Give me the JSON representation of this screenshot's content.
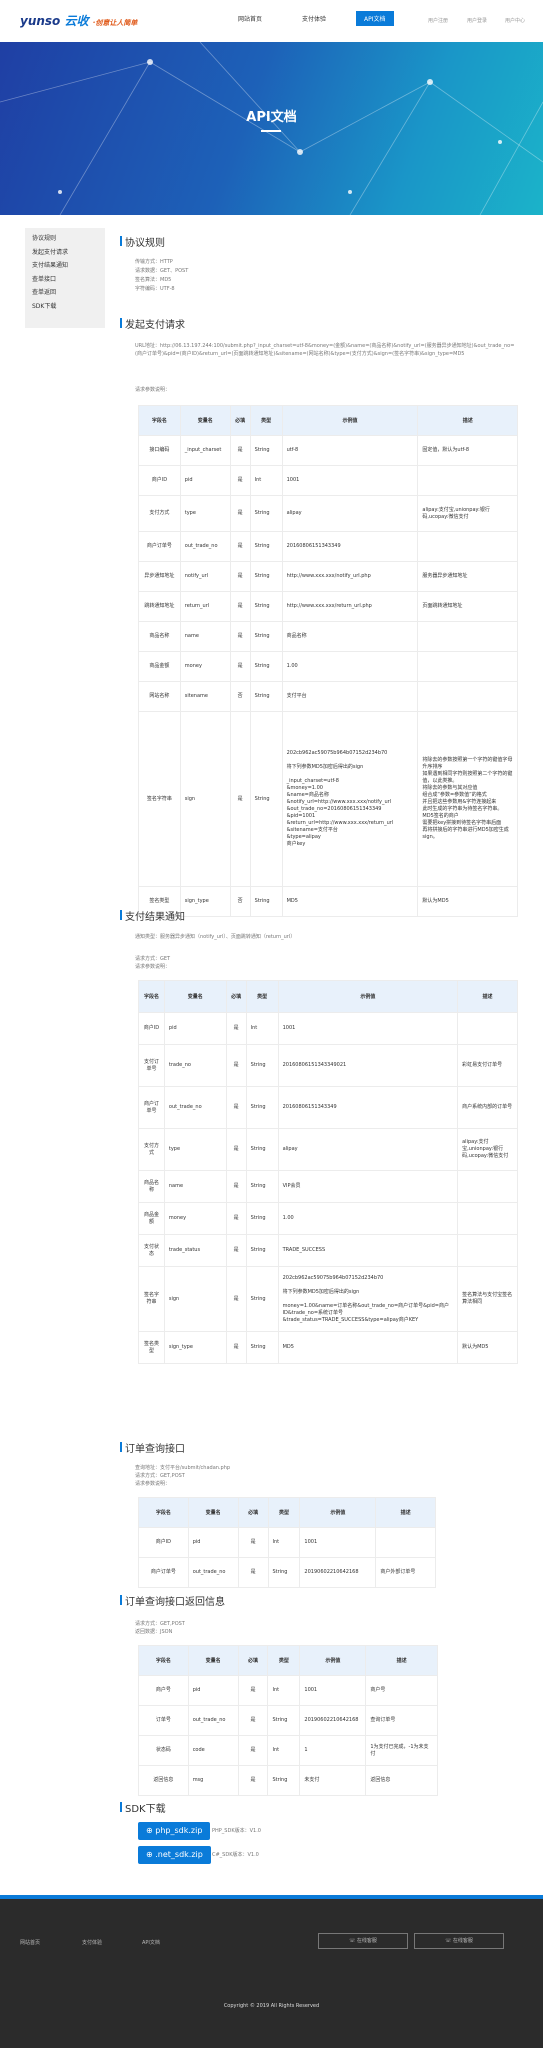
{
  "header": {
    "logo_main": "yunso",
    "logo_cn": "云收",
    "logo_slogan": "·创意让人简单",
    "nav": [
      "网站首页",
      "支付体验",
      "API文档"
    ],
    "links": [
      "用户注册",
      "用户登录",
      "用户中心"
    ]
  },
  "hero": {
    "title": "API文档"
  },
  "sidebar": [
    "协议规则",
    "发起支付请求",
    "支付结果通知",
    "查单接口",
    "查单返回",
    "SDK下载"
  ],
  "s1": {
    "title": "协议规则",
    "lines": [
      "传输方式：HTTP",
      "请求数据：GET、POST",
      "签名算法：MD5",
      "字符编码：UTF-8"
    ]
  },
  "s2": {
    "title": "发起支付请求",
    "url": "URL地址：http://06.13.197.244:100/submit.php?_input_charset=utf-8&money=(金额)&name=(商品名称)&notify_url=(服务器异步通知地址)&out_trade_no=(商户订单号)&pid=(商户ID)&return_url=(页面跳转通知地址)&sitename=(网站名称)&type=(支付方式)&sign=(签名字符串)&sign_type=MD5",
    "param_note": "请求参数说明：",
    "headers": [
      "字段名",
      "变量名",
      "必填",
      "类型",
      "示例值",
      "描述"
    ],
    "rows": [
      [
        "接口编码",
        "_input_charset",
        "是",
        "String",
        "utf-8",
        "固定值，默认为utf-8"
      ],
      [
        "商户ID",
        "pid",
        "是",
        "Int",
        "1001",
        ""
      ],
      [
        "支付方式",
        "type",
        "是",
        "String",
        "alipay",
        "alipay:支付宝,unionpay:银行码,ucopay:微信支付"
      ],
      [
        "商户订单号",
        "out_trade_no",
        "是",
        "String",
        "20160806151343349",
        ""
      ],
      [
        "异步通知地址",
        "notify_url",
        "是",
        "String",
        "http://www.xxx.xxx/notify_url.php",
        "服务器异步通知地址"
      ],
      [
        "跳转通知地址",
        "return_url",
        "是",
        "String",
        "http://www.xxx.xxx/return_url.php",
        "页面跳转通知地址"
      ],
      [
        "商品名称",
        "name",
        "是",
        "String",
        "商品名称",
        ""
      ],
      [
        "商品金额",
        "money",
        "是",
        "String",
        "1.00",
        ""
      ],
      [
        "网站名称",
        "sitename",
        "否",
        "String",
        "支付平台",
        ""
      ],
      [
        "签名字符串",
        "sign",
        "是",
        "String",
        "202cb962ac59075b964b07152d234b70\n\n将下列参数MD5加密后得出的sign\n\n_input_charset=utf-8\n&money=1.00\n&name=商品名称\n&notify_url=http://www.xxx.xxx/notify_url\n&out_trade_no=20160806151343349\n&pid=1001\n&return_url=http://www.xxx.xxx/return_url\n&sitename=支付平台\n&type=alipay\n商户key",
        "将除去的参数按照第一个字符的键值字母升序排序\n如果遇到相同字符则按照第二个字符的键值，以此类推。\n将除去的参数与其对应值\n组合成“参数=参数值”的格式\n并且把这些参数用&字符连接起来\n此时生成的字符串为待签名字符串。\nMD5签名的商户\n需要把key拼接到待签名字符串后面\n再将拼接后的字符串进行MD5加密生成sign。"
      ],
      [
        "签名类型",
        "sign_type",
        "否",
        "String",
        "MD5",
        "默认为MD5"
      ]
    ],
    "sign_link": "支付宝签名算法"
  },
  "s3": {
    "title": "支付结果通知",
    "desc": "通知类型：服务器异步通知（notify_url）、页面跳转通知（return_url）",
    "lines": [
      "请求方式：GET",
      "请求参数说明："
    ],
    "headers": [
      "字段名",
      "变量名",
      "必填",
      "类型",
      "示例值",
      "描述"
    ],
    "rows": [
      [
        "商户ID",
        "pid",
        "是",
        "Int",
        "1001",
        ""
      ],
      [
        "支付订单号",
        "trade_no",
        "是",
        "String",
        "20160806151343349021",
        "彩虹易支付订单号"
      ],
      [
        "商户订单号",
        "out_trade_no",
        "是",
        "String",
        "20160806151343349",
        "商户系统内部的订单号"
      ],
      [
        "支付方式",
        "type",
        "是",
        "String",
        "alipay",
        "alipay:支付宝,unionpay:银行码,ucopay:微信支付"
      ],
      [
        "商品名称",
        "name",
        "是",
        "String",
        "VIP会员",
        ""
      ],
      [
        "商品金额",
        "money",
        "是",
        "String",
        "1.00",
        ""
      ],
      [
        "支付状态",
        "trade_status",
        "是",
        "String",
        "TRADE_SUCCESS",
        ""
      ],
      [
        "签名字符串",
        "sign",
        "是",
        "String",
        "202cb962ac59075b964b07152d234b70\n\n将下列参数MD5加密后得出的sign\n\nmoney=1.00&name=订单名称&out_trade_no=商户订单号&pid=商户ID&trade_no=系统订单号&trade_status=TRADE_SUCCESS&type=alipay商户KEY",
        "签名算法与支付宝签名算法相同"
      ],
      [
        "签名类型",
        "sign_type",
        "是",
        "String",
        "MD5",
        "默认为MD5"
      ]
    ]
  },
  "s4": {
    "title": "订单查询接口",
    "lines": [
      "查询地址：支付平台/submit/chadan.php",
      "请求方式：GET,POST",
      "请求参数说明："
    ],
    "headers": [
      "字段名",
      "变量名",
      "必填",
      "类型",
      "示例值",
      "描述"
    ],
    "rows": [
      [
        "商户ID",
        "pid",
        "是",
        "Int",
        "1001",
        ""
      ],
      [
        "商户订单号",
        "out_trade_no",
        "是",
        "String",
        "20190602210642168",
        "商户外部订单号"
      ]
    ]
  },
  "s5": {
    "title": "订单查询接口返回信息",
    "lines": [
      "请求方式：GET,POST",
      "返回数据：JSON"
    ],
    "headers": [
      "字段名",
      "变量名",
      "必填",
      "类型",
      "示例值",
      "描述"
    ],
    "rows": [
      [
        "商户号",
        "pid",
        "是",
        "Int",
        "1001",
        "商户号"
      ],
      [
        "订单号",
        "out_trade_no",
        "是",
        "String",
        "20190602210642168",
        "查询订单号"
      ],
      [
        "状态码",
        "code",
        "是",
        "Int",
        "1",
        "1为支付已完成，-1为未支付"
      ],
      [
        "返回信息",
        "msg",
        "是",
        "String",
        "未支付",
        "返回信息"
      ]
    ]
  },
  "s6": {
    "title": "SDK下载",
    "buttons": [
      {
        "label": "php_sdk.zip",
        "note": "PHP_SDK版本：V1.0"
      },
      {
        "label": ".net_sdk.zip",
        "note": "C#_SDK版本：V1.0"
      }
    ]
  },
  "footer": {
    "links": [
      "网站首页",
      "支付体验",
      "API文档"
    ],
    "buttons": [
      "在线客服",
      "在线客服"
    ],
    "copyright": "Copyright © 2019 All Rights Reserved"
  }
}
